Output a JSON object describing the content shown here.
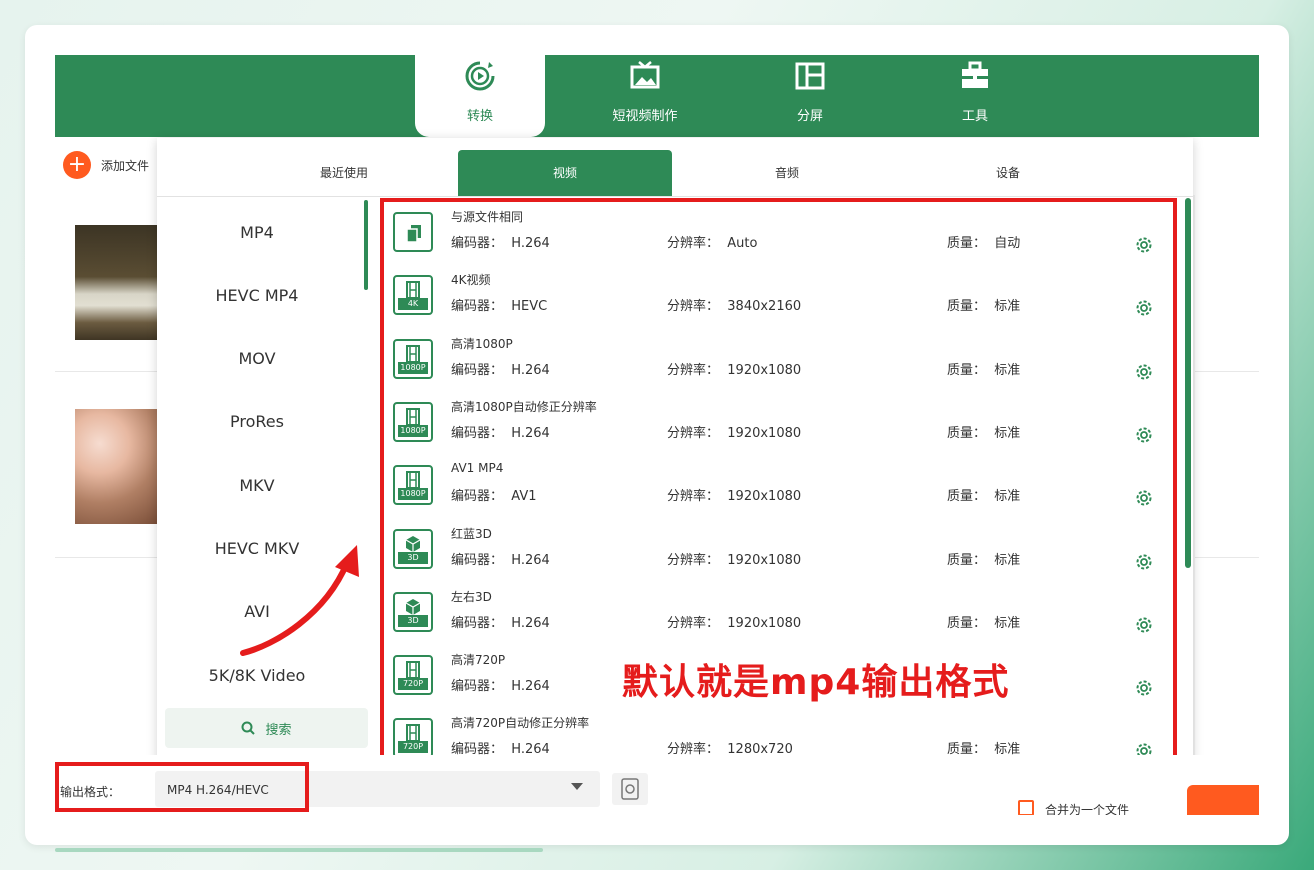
{
  "nav": {
    "items": [
      {
        "label": "转换",
        "icon": "convert-icon",
        "active": true
      },
      {
        "label": "短视频制作",
        "icon": "short-video-icon",
        "active": false
      },
      {
        "label": "分屏",
        "icon": "split-screen-icon",
        "active": false
      },
      {
        "label": "工具",
        "icon": "toolbox-icon",
        "active": false
      }
    ]
  },
  "toolbar": {
    "add_file_label": "添加文件"
  },
  "format_panel": {
    "tabs": [
      "最近使用",
      "视频",
      "音频",
      "设备"
    ],
    "active_tab": "视频",
    "formats": [
      "MP4",
      "HEVC MP4",
      "MOV",
      "ProRes",
      "MKV",
      "HEVC MKV",
      "AVI",
      "5K/8K Video"
    ],
    "search_label": "搜索",
    "presets": [
      {
        "title": "与源文件相同",
        "codec": "H.264",
        "resolution": "Auto",
        "quality": "自动",
        "badge": ""
      },
      {
        "title": "4K视频",
        "codec": "HEVC",
        "resolution": "3840x2160",
        "quality": "标准",
        "badge": "4K"
      },
      {
        "title": "高清1080P",
        "codec": "H.264",
        "resolution": "1920x1080",
        "quality": "标准",
        "badge": "1080P"
      },
      {
        "title": "高清1080P自动修正分辨率",
        "codec": "H.264",
        "resolution": "1920x1080",
        "quality": "标准",
        "badge": "1080P"
      },
      {
        "title": "AV1 MP4",
        "codec": "AV1",
        "resolution": "1920x1080",
        "quality": "标准",
        "badge": "1080P"
      },
      {
        "title": "红蓝3D",
        "codec": "H.264",
        "resolution": "1920x1080",
        "quality": "标准",
        "badge": "3D"
      },
      {
        "title": "左右3D",
        "codec": "H.264",
        "resolution": "1920x1080",
        "quality": "标准",
        "badge": "3D"
      },
      {
        "title": "高清720P",
        "codec": "H.264",
        "resolution": "",
        "quality": "",
        "badge": "720P"
      },
      {
        "title": "高清720P自动修正分辨率",
        "codec": "H.264",
        "resolution": "1280x720",
        "quality": "标准",
        "badge": "720P"
      }
    ],
    "labels": {
      "codec": "编码器：",
      "resolution": "分辨率：",
      "quality": "质量："
    }
  },
  "annotation": {
    "text": "默认就是mp4输出格式",
    "color": "#e51c1c"
  },
  "bottom": {
    "output_format_label": "输出格式：",
    "output_format_value": "MP4 H.264/HEVC",
    "merge_label": "合并为一个文件"
  },
  "colors": {
    "brand": "#2e8a56",
    "accent": "#ff5a1f",
    "annotation": "#e51c1c"
  }
}
